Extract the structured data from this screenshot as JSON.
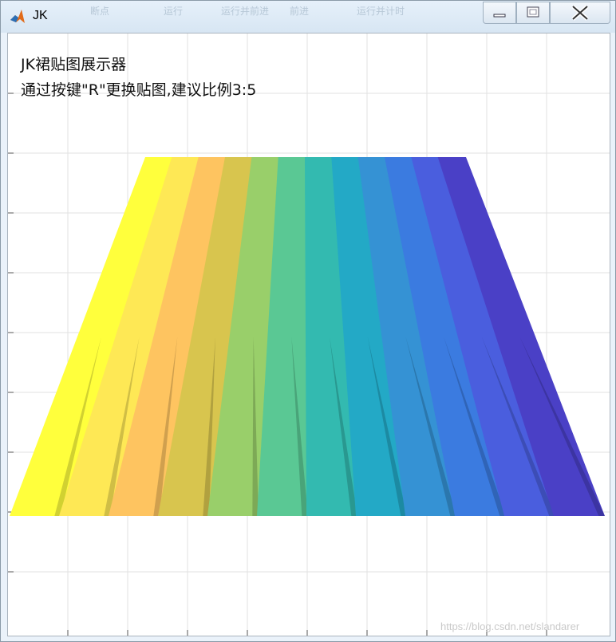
{
  "window": {
    "title": "JK",
    "ghost_toolbar": [
      "断点",
      "运行",
      "运行并前进",
      "前进",
      "运行并计时"
    ]
  },
  "figure": {
    "title_line1": "JK裙贴图展示器",
    "title_line2": "通过按键\"R\"更换贴图,建议比例3:5",
    "watermark": "https://blog.csdn.net/slandarer"
  },
  "colors": {
    "strips": [
      "#ffff3c",
      "#fee855",
      "#fec460",
      "#d8c54e",
      "#99cf6a",
      "#5ac894",
      "#33bab0",
      "#23a9c6",
      "#3592d4",
      "#3b7be0",
      "#4a5ede",
      "#4a40c6"
    ],
    "grid": "#e2e2e2",
    "titlebar": "#dbe8f4"
  }
}
